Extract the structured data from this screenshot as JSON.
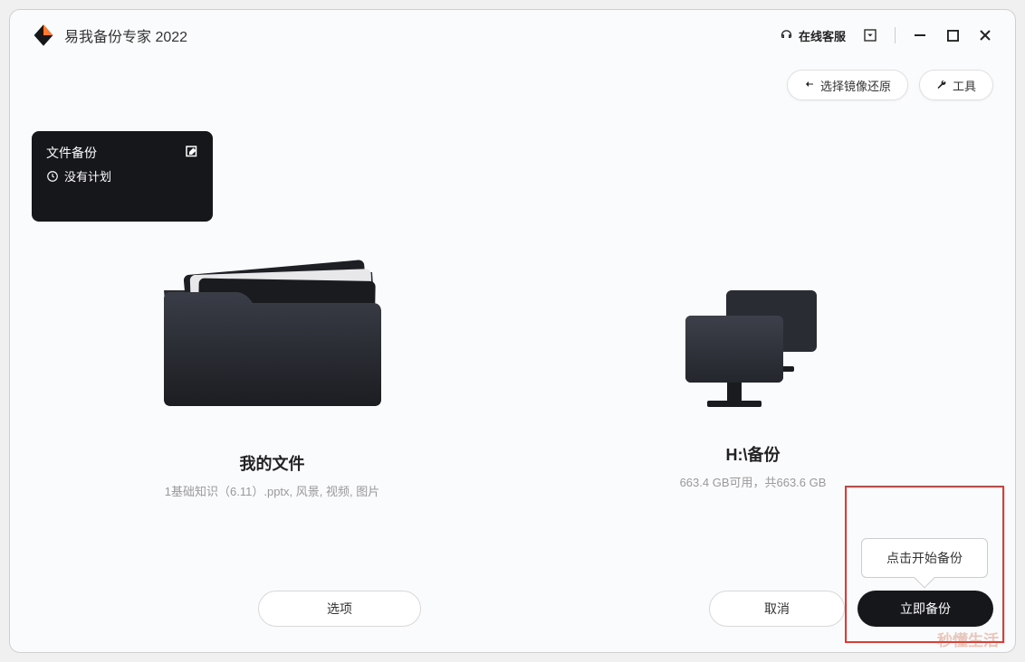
{
  "app": {
    "title": "易我备份专家 2022"
  },
  "titlebar": {
    "support_label": "在线客服"
  },
  "toolbar": {
    "restore_label": "选择镜像还原",
    "tools_label": "工具"
  },
  "task_card": {
    "title": "文件备份",
    "schedule": "没有计划"
  },
  "source": {
    "title": "我的文件",
    "detail": "1基础知识（6.11）.pptx, 风景, 视频, 图片"
  },
  "destination": {
    "title": "H:\\备份",
    "detail": "663.4 GB可用，共663.6 GB"
  },
  "footer": {
    "options_label": "选项",
    "cancel_label": "取消",
    "backup_label": "立即备份"
  },
  "tooltip": {
    "text": "点击开始备份"
  },
  "watermark": "秒懂生活"
}
